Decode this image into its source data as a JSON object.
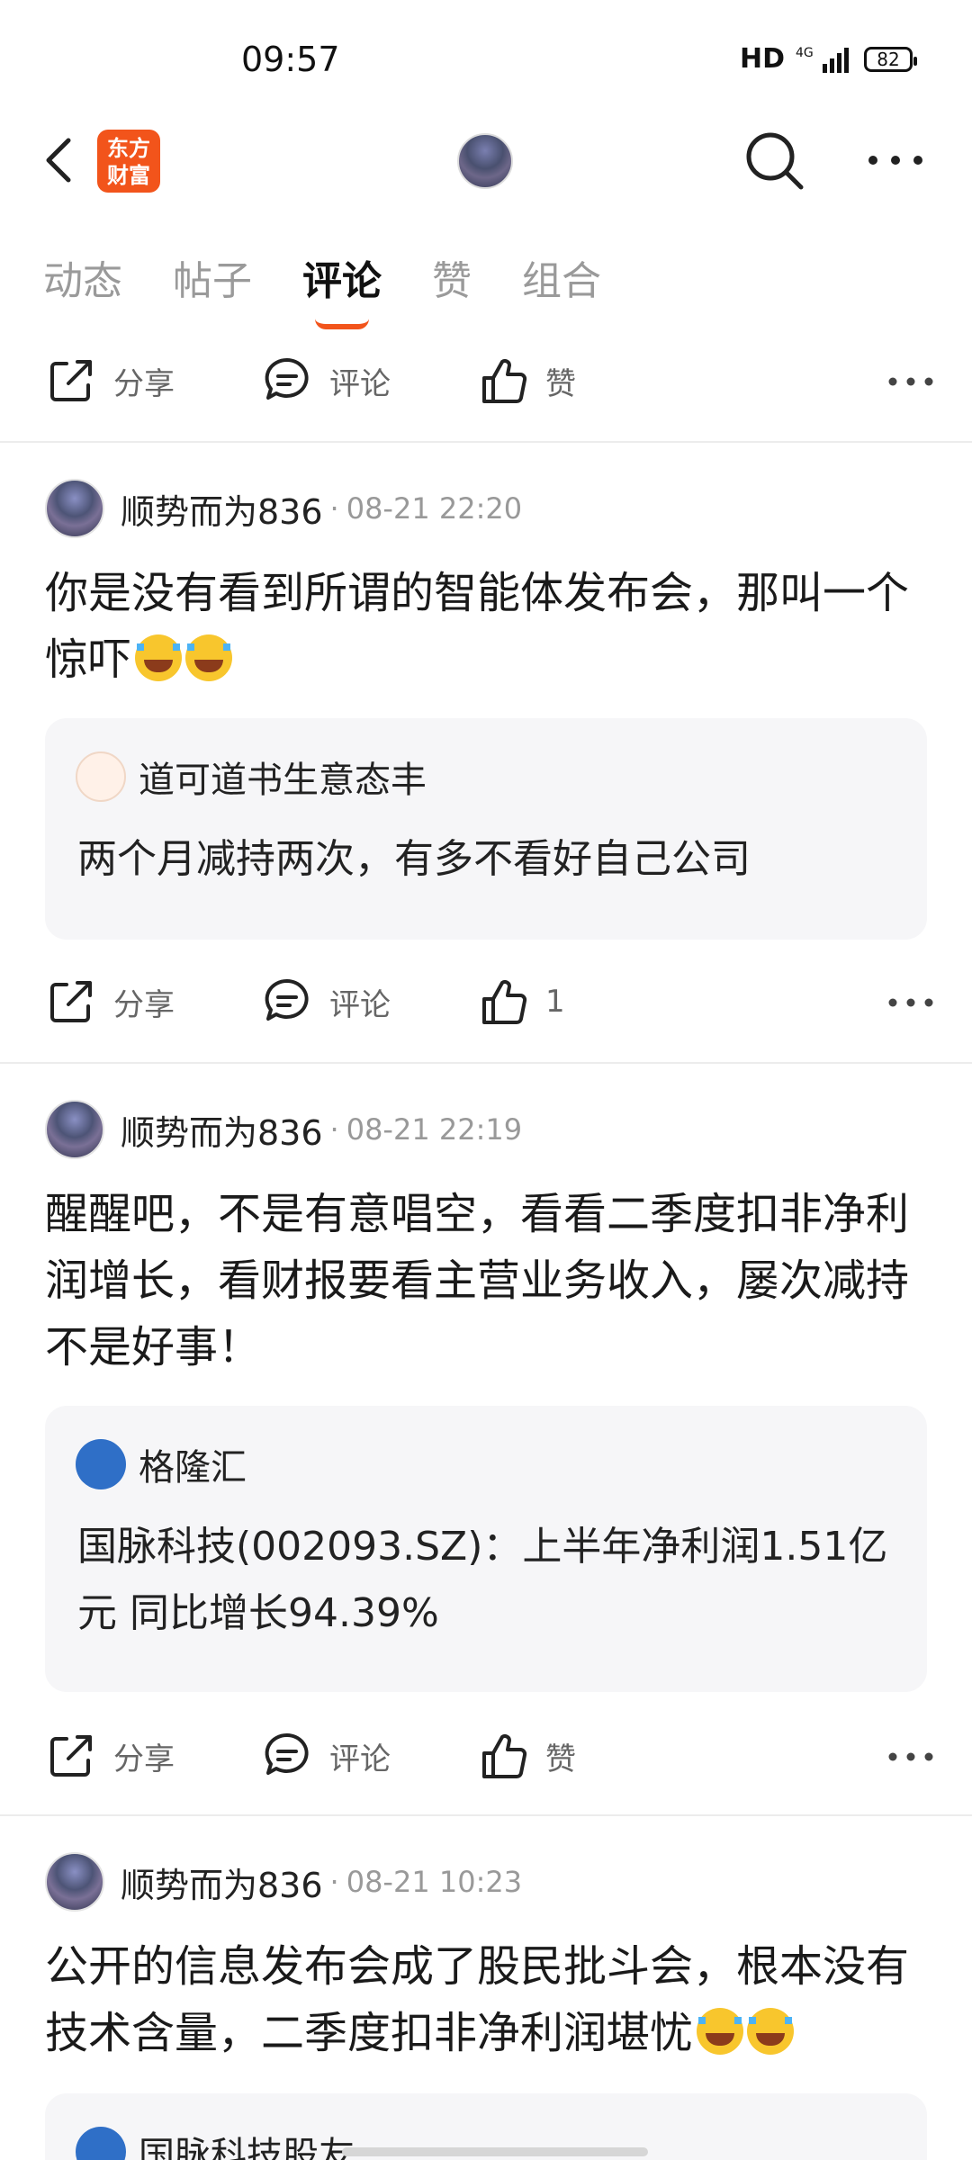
{
  "status": {
    "time": "09:57",
    "hd": "HD",
    "network": "4G",
    "battery": "82"
  },
  "nav": {
    "logo_text": "东方财富"
  },
  "tabs": [
    {
      "label": "动态"
    },
    {
      "label": "帖子"
    },
    {
      "label": "评论"
    },
    {
      "label": "赞"
    },
    {
      "label": "组合"
    }
  ],
  "top_actions": {
    "share": "分享",
    "comment": "评论",
    "like": "赞"
  },
  "comments": [
    {
      "author": "顺势而为836",
      "dot": "·",
      "time": "08-21 22:20",
      "text": "你是没有看到所谓的智能体发布会，那叫一个惊吓",
      "quote_author": "道可道书生意态丰",
      "quote_text": "两个月减持两次，有多不看好自己公司",
      "share": "分享",
      "comment": "评论",
      "like": "1"
    },
    {
      "author": "顺势而为836",
      "dot": "·",
      "time": "08-21 22:19",
      "text": "醒醒吧，不是有意唱空，看看二季度扣非净利润增长，看财报要看主营业务收入，屡次减持不是好事！",
      "quote_author": "格隆汇",
      "quote_text": "国脉科技(002093.SZ)：上半年净利润1.51亿元 同比增长94.39%",
      "share": "分享",
      "comment": "评论",
      "like": "赞"
    },
    {
      "author": "顺势而为836",
      "dot": "·",
      "time": "08-21 10:23",
      "text": "公开的信息发布会成了股民批斗会，根本没有技术含量，二季度扣非净利润堪忧",
      "quote_author": "国脉科技股友"
    }
  ]
}
